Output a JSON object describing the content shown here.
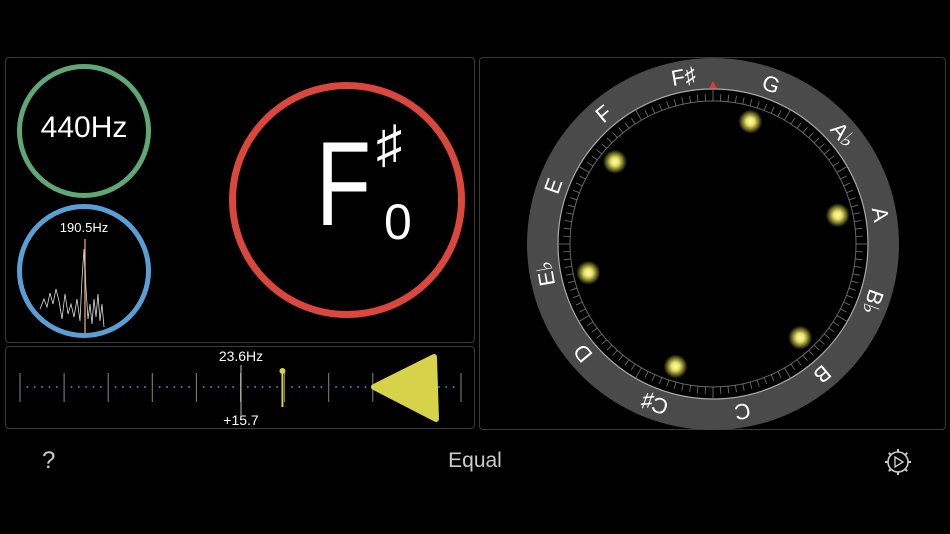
{
  "reference": {
    "label": "440Hz",
    "color": "#5fa777"
  },
  "spectrum": {
    "peak_label": "190.5Hz",
    "color": "#5a9fd4"
  },
  "note": {
    "letter": "F",
    "accidental": "♯",
    "octave": "0",
    "color": "#d9473d"
  },
  "meter": {
    "freq_label": "23.6Hz",
    "cents_label": "+15.7",
    "cents_value": 15.7,
    "indicator_color": "#d6d24a"
  },
  "wheel": {
    "notes": [
      "F♯",
      "G",
      "A♭",
      "A",
      "B♭",
      "B",
      "C",
      "C♯",
      "D",
      "E♭",
      "E",
      "F"
    ],
    "marker_color": "#e03a2e",
    "glow_color": "#e8e25a"
  },
  "footer": {
    "help_label": "?",
    "temperament_label": "Equal",
    "settings_icon": "gear-icon"
  }
}
